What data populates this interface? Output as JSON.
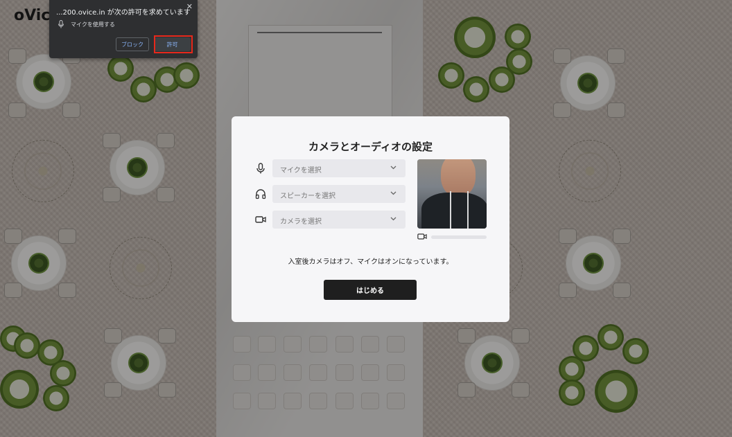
{
  "app": {
    "logo_text": "oVice",
    "accent": "#1f1f1f"
  },
  "permission_prompt": {
    "title": "...200.ovice.in が次の許可を求めています",
    "request_item": "マイクを使用する",
    "block_label": "ブロック",
    "allow_label": "許可",
    "close_icon": "close-icon",
    "mic_icon": "microphone-icon",
    "highlight_color": "#e8281b"
  },
  "modal": {
    "title": "カメラとオーディオの設定",
    "microphone": {
      "icon": "microphone-icon",
      "placeholder": "マイクを選択"
    },
    "speaker": {
      "icon": "headphones-icon",
      "placeholder": "スピーカーを選択"
    },
    "camera": {
      "icon": "video-camera-icon",
      "placeholder": "カメラを選択"
    },
    "preview": {
      "icon": "video-camera-icon",
      "level": 0
    },
    "note": "入室後カメラはオフ、マイクはオンになっています。",
    "start_label": "はじめる"
  }
}
